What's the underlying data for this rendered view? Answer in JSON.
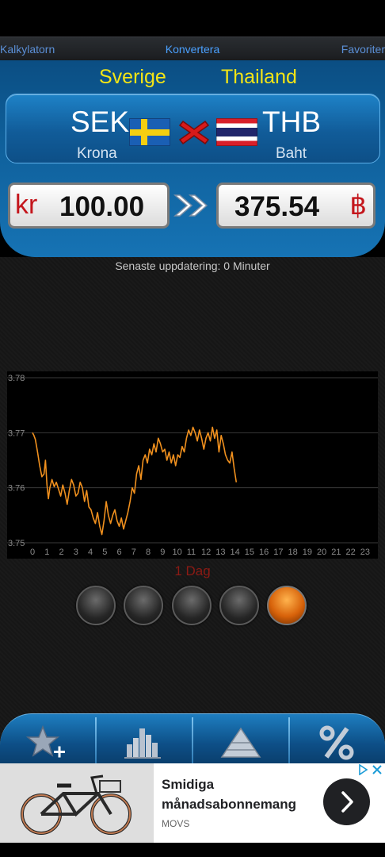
{
  "tabs": {
    "left": "Kalkylatorn",
    "center": "Konvertera",
    "right": "Favoriter"
  },
  "pair": {
    "from_country": "Sverige",
    "to_country": "Thailand",
    "from_code": "SEK",
    "to_code": "THB",
    "from_name": "Krona",
    "to_name": "Baht",
    "from_flag_icon": "sweden-flag-icon",
    "to_flag_icon": "thailand-flag-icon"
  },
  "amounts": {
    "from_symbol": "kr",
    "from_value": "100.00",
    "to_value": "375.54",
    "to_symbol": "฿"
  },
  "status": {
    "updated": "Senaste uppdatering: 0 Minuter"
  },
  "period": {
    "label": "1 Dag",
    "selected_index": 4,
    "count": 5
  },
  "bottom_bar": {
    "icons": [
      "star-add-icon",
      "bar-chart-icon",
      "pyramid-icon",
      "percent-icon"
    ]
  },
  "ad": {
    "title": "Smidiga månadsabonnemang",
    "brand": "MOVS"
  },
  "colors": {
    "accent_yellow": "#f4e515",
    "line_orange": "#f0901e",
    "currency_red": "#c4161c",
    "panel_blue": "#0f5f9a"
  },
  "chart_data": {
    "type": "line",
    "x_ticks": [
      "0",
      "1",
      "2",
      "3",
      "4",
      "5",
      "6",
      "7",
      "8",
      "9",
      "10",
      "11",
      "12",
      "13",
      "14",
      "15",
      "16",
      "17",
      "18",
      "19",
      "20",
      "21",
      "22",
      "23"
    ],
    "y_ticks": [
      "3.78",
      "3.77",
      "3.76",
      "3.75"
    ],
    "ylim": [
      3.75,
      3.78
    ],
    "xlim": [
      0,
      24
    ],
    "series": [
      {
        "x": [
          0,
          0.1,
          0.2,
          0.35,
          0.5,
          0.65,
          0.8,
          0.9,
          1.0,
          1.1,
          1.2,
          1.35,
          1.5,
          1.65,
          1.8,
          1.95,
          2.1,
          2.25,
          2.4,
          2.55,
          2.7,
          2.85,
          3.0,
          3.15,
          3.3,
          3.45,
          3.6,
          3.75,
          3.9,
          4.05,
          4.2,
          4.35,
          4.5,
          4.65,
          4.8,
          4.95,
          5.1,
          5.25,
          5.4,
          5.55,
          5.7,
          5.85,
          6.0,
          6.15,
          6.3,
          6.45,
          6.6,
          6.75,
          6.9,
          7.05,
          7.2,
          7.35,
          7.5,
          7.65,
          7.8,
          7.95,
          8.1,
          8.25,
          8.4,
          8.55,
          8.7,
          8.85,
          9.0,
          9.15,
          9.3,
          9.45,
          9.6,
          9.75,
          9.9,
          10.05,
          10.2,
          10.35,
          10.5,
          10.65,
          10.8,
          10.95,
          11.1,
          11.25,
          11.4,
          11.55,
          11.7,
          11.85,
          12.0,
          12.15,
          12.3,
          12.45,
          12.6,
          12.75,
          12.9,
          13.05,
          13.2,
          13.35,
          13.5,
          13.65,
          13.8,
          13.95,
          14.1
        ],
        "y": [
          3.77,
          3.7695,
          3.7688,
          3.7665,
          3.764,
          3.762,
          3.7625,
          3.765,
          3.7605,
          3.758,
          3.76,
          3.7615,
          3.7602,
          3.761,
          3.7598,
          3.7585,
          3.7605,
          3.759,
          3.757,
          3.7595,
          3.7615,
          3.7605,
          3.7585,
          3.759,
          3.761,
          3.76,
          3.7575,
          3.7595,
          3.7565,
          3.756,
          3.7545,
          3.7535,
          3.7555,
          3.753,
          3.7515,
          3.754,
          3.7575,
          3.755,
          3.7535,
          3.755,
          3.756,
          3.754,
          3.753,
          3.7545,
          3.7525,
          3.754,
          3.7555,
          3.7575,
          3.76,
          3.759,
          3.7625,
          3.764,
          3.7615,
          3.765,
          3.766,
          3.7645,
          3.767,
          3.766,
          3.768,
          3.7665,
          3.769,
          3.768,
          3.7665,
          3.767,
          3.765,
          3.7665,
          3.7645,
          3.766,
          3.764,
          3.766,
          3.7655,
          3.7675,
          3.7665,
          3.769,
          3.7705,
          3.7695,
          3.771,
          3.77,
          3.7685,
          3.7705,
          3.769,
          3.767,
          3.769,
          3.77,
          3.7685,
          3.771,
          3.769,
          3.7705,
          3.7665,
          3.7695,
          3.768,
          3.766,
          3.765,
          3.7645,
          3.7665,
          3.7635,
          3.761
        ]
      }
    ],
    "grid": true,
    "legend": "none"
  }
}
